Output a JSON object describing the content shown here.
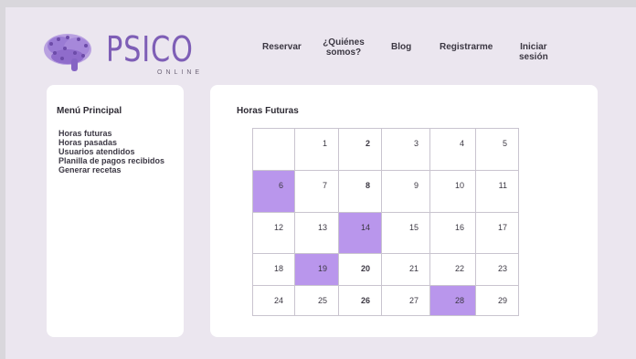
{
  "brand": {
    "name": "PSICO",
    "tagline": "ONLINE",
    "color": "#7e5eb6"
  },
  "nav": [
    {
      "label": "Reservar"
    },
    {
      "label": "¿Quiénes somos?"
    },
    {
      "label": "Blog"
    },
    {
      "label": "Registrarme"
    },
    {
      "label": "Iniciar sesión"
    }
  ],
  "menu": {
    "title": "Menú Principal",
    "items": [
      {
        "label": "Horas futuras"
      },
      {
        "label": "Horas pasadas"
      },
      {
        "label": "Usuarios atendidos"
      },
      {
        "label": "Planilla de pagos recibidos"
      },
      {
        "label": "Generar recetas"
      }
    ]
  },
  "main": {
    "title": "Horas Futuras",
    "highlight_color": "#b996ec",
    "calendar_rows": [
      [
        "",
        "1",
        "2",
        "3",
        "4",
        "5"
      ],
      [
        "6",
        "7",
        "8",
        "9",
        "10",
        "11"
      ],
      [
        "12",
        "13",
        "14",
        "15",
        "16",
        "17"
      ],
      [
        "18",
        "19",
        "20",
        "21",
        "22",
        "23"
      ],
      [
        "24",
        "25",
        "26",
        "27",
        "28",
        "29"
      ]
    ],
    "highlighted_days": [
      "6",
      "14",
      "19",
      "28"
    ]
  }
}
